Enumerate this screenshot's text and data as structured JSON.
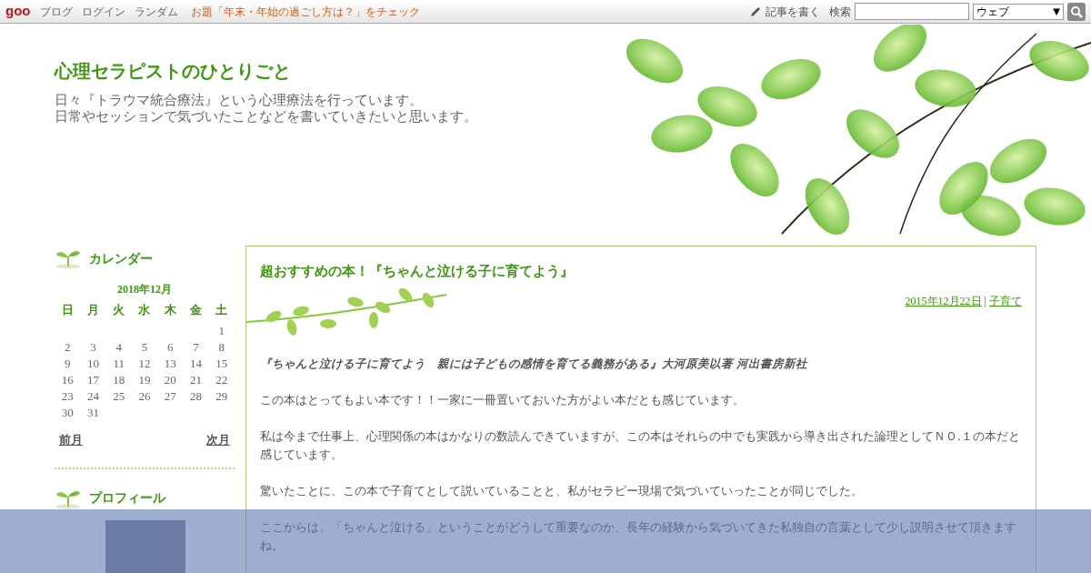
{
  "topbar": {
    "logo": "goo",
    "links": [
      "ブログ",
      "ログイン",
      "ランダム"
    ],
    "promo": "お題「年末・年始の過ごし方は？」をチェック",
    "write_link": "記事を書く",
    "search_label": "検索",
    "search_scope": "ウェブ",
    "scope_arrow": "▼"
  },
  "header": {
    "title": "心理セラピストのひとりごと",
    "description": [
      "日々『トラウマ統合療法』という心理療法を行っています。",
      "日常やセッションで気づいたことなどを書いていきたいと思います。"
    ]
  },
  "sidebar": {
    "calendar": {
      "heading": "カレンダー",
      "month": "2018年12月",
      "weekdays": [
        "日",
        "月",
        "火",
        "水",
        "木",
        "金",
        "土"
      ],
      "weeks": [
        {
          "kind": "first",
          "days": [
            "1"
          ]
        },
        {
          "kind": "week",
          "days": [
            "2",
            "3",
            "4",
            "5",
            "6",
            "7",
            "8"
          ]
        },
        {
          "kind": "week",
          "days": [
            "9",
            "10",
            "11",
            "12",
            "13",
            "14",
            "15"
          ]
        },
        {
          "kind": "week",
          "days": [
            "16",
            "17",
            "18",
            "19",
            "20",
            "21",
            "22"
          ]
        },
        {
          "kind": "week",
          "days": [
            "23",
            "24",
            "25",
            "26",
            "27",
            "28",
            "29"
          ]
        },
        {
          "kind": "week",
          "days": [
            "30",
            "31"
          ]
        }
      ],
      "prev": "前月",
      "next": "次月"
    },
    "profile": {
      "heading": "プロフィール"
    }
  },
  "post": {
    "title": "超おすすめの本！『ちゃんと泣ける子に育てよう』",
    "date": "2015年12月22日",
    "separator": "|",
    "category": "子育て",
    "paragraphs": [
      {
        "kind": "book",
        "text": "『ちゃんと泣ける子に育てよう　親には子どもの感情を育てる義務がある』大河原美以著 河出書房新社"
      },
      {
        "kind": "body",
        "text": "この本はとってもよい本です！！一家に一冊置いておいた方がよい本だとも感じています。"
      },
      {
        "kind": "body",
        "text": "私は今まで仕事上、心理関係の本はかなりの数読んできていますが、この本はそれらの中でも実践から導き出された論理としてＮＯ.１の本だと感じています。"
      },
      {
        "kind": "body",
        "text": "驚いたことに、この本で子育てとして説いていることと、私がセラピー現場で気づいていったことが同じでした。"
      },
      {
        "kind": "body",
        "text": "ここからは、「ちゃんと泣ける」ということがどうして重要なのか、長年の経験から気づいてきた私独自の言葉として少し説明させて頂きますね。"
      }
    ]
  }
}
